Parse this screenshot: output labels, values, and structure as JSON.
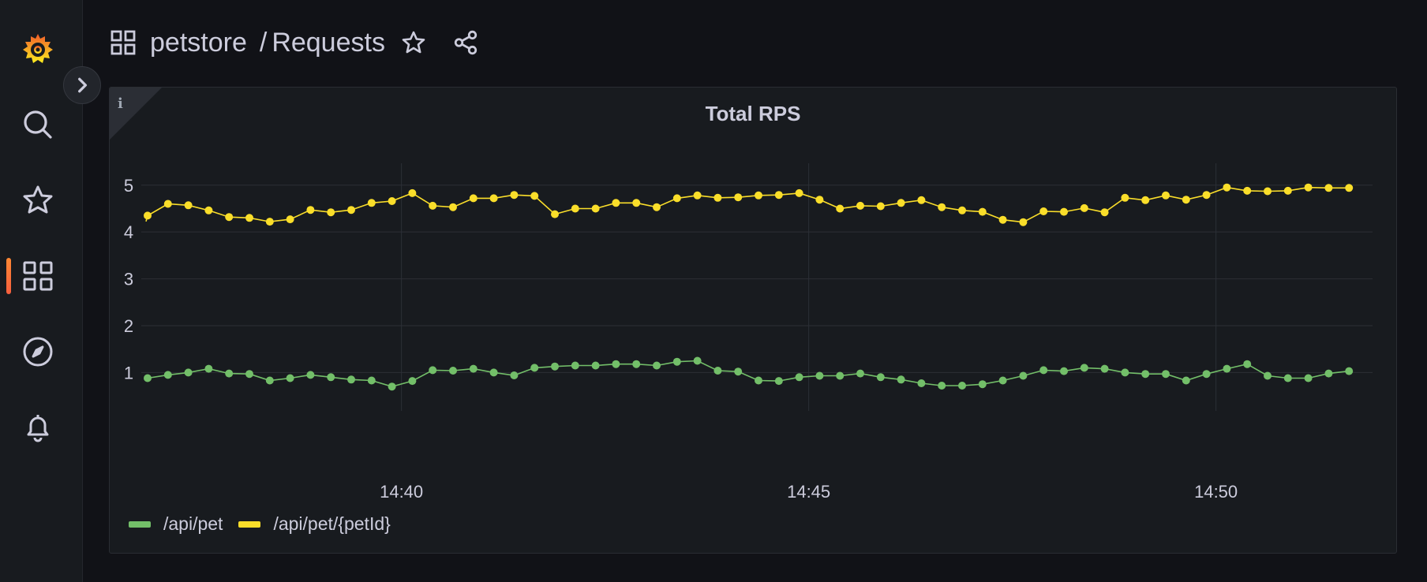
{
  "header": {
    "folder": "petstore",
    "separator": "/",
    "title": "Requests"
  },
  "sidebar": {
    "items": [
      {
        "name": "grafana-logo"
      },
      {
        "name": "search"
      },
      {
        "name": "starred"
      },
      {
        "name": "dashboards",
        "active": true
      },
      {
        "name": "explore"
      },
      {
        "name": "alerting"
      }
    ]
  },
  "panel": {
    "title": "Total RPS",
    "info": "i"
  },
  "colors": {
    "series_api_pet": "#73bf69",
    "series_api_pet_id": "#fade2a",
    "accent": "#f55f3e"
  },
  "chart_data": {
    "type": "line",
    "title": "Total RPS",
    "xlabel": "",
    "ylabel": "",
    "x_ticks": [
      "14:40",
      "14:45",
      "14:50"
    ],
    "y_ticks": [
      1,
      2,
      3,
      4,
      5
    ],
    "ylim": [
      0.35,
      5.4
    ],
    "grid": true,
    "legend_position": "bottom-left",
    "x_start": "14:36:53",
    "x_step_seconds": 15,
    "series": [
      {
        "name": "/api/pet",
        "color": "#73bf69",
        "values": [
          0.88,
          0.95,
          1.0,
          1.08,
          0.98,
          0.97,
          0.83,
          0.88,
          0.95,
          0.9,
          0.85,
          0.83,
          0.7,
          0.82,
          1.05,
          1.04,
          1.08,
          1.0,
          0.94,
          1.1,
          1.13,
          1.15,
          1.15,
          1.18,
          1.18,
          1.15,
          1.23,
          1.25,
          1.04,
          1.02,
          0.83,
          0.82,
          0.9,
          0.93,
          0.93,
          0.98,
          0.9,
          0.85,
          0.77,
          0.72,
          0.72,
          0.75,
          0.83,
          0.93,
          1.05,
          1.03,
          1.1,
          1.08,
          1.0,
          0.97,
          0.97,
          0.83,
          0.97,
          1.08,
          1.18,
          0.93,
          0.88,
          0.88,
          0.98,
          1.03
        ]
      },
      {
        "name": "/api/pet/{petId}",
        "color": "#fade2a",
        "values": [
          4.35,
          4.6,
          4.57,
          4.46,
          4.32,
          4.3,
          4.22,
          4.27,
          4.47,
          4.42,
          4.47,
          4.62,
          4.66,
          4.83,
          4.56,
          4.53,
          4.72,
          4.72,
          4.79,
          4.77,
          4.38,
          4.5,
          4.5,
          4.62,
          4.62,
          4.53,
          4.72,
          4.78,
          4.73,
          4.74,
          4.78,
          4.79,
          4.83,
          4.69,
          4.5,
          4.56,
          4.55,
          4.62,
          4.68,
          4.53,
          4.46,
          4.43,
          4.26,
          4.21,
          4.44,
          4.43,
          4.51,
          4.42,
          4.73,
          4.68,
          4.78,
          4.69,
          4.79,
          4.95,
          4.88,
          4.87,
          4.88,
          4.95,
          4.94,
          4.94
        ]
      }
    ]
  }
}
